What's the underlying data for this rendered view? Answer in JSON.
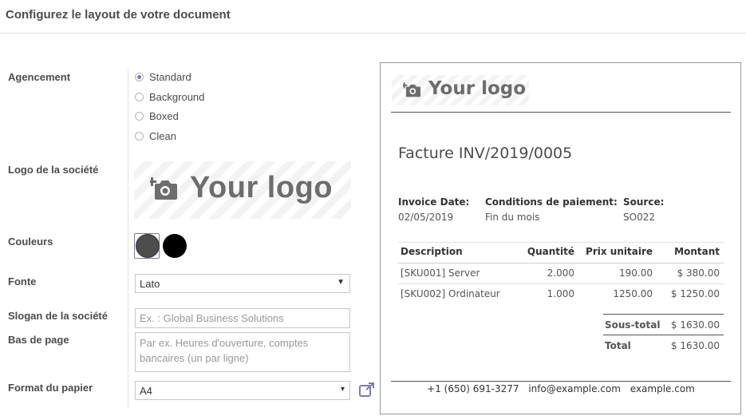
{
  "header": {
    "title": "Configurez le layout de votre document"
  },
  "labels": {
    "layout": "Agencement",
    "logo": "Logo de la société",
    "colors": "Couleurs",
    "font": "Fonte",
    "tagline": "Slogan de la société",
    "footer": "Bas de page",
    "paper": "Format du papier"
  },
  "layout_options": [
    {
      "label": "Standard",
      "selected": true
    },
    {
      "label": "Background",
      "selected": false
    },
    {
      "label": "Boxed",
      "selected": false
    },
    {
      "label": "Clean",
      "selected": false
    }
  ],
  "logo_placeholder": "Your logo",
  "colors": {
    "primary": "#4d4d4d",
    "secondary": "#000000",
    "accent": "#7c7bad"
  },
  "font": {
    "value": "Lato"
  },
  "tagline": {
    "placeholder": "Ex. : Global Business Solutions"
  },
  "footer_field": {
    "placeholder": "Par ex. Heures d'ouverture, comptes bancaires (un par ligne)"
  },
  "paper": {
    "value": "A4"
  },
  "preview": {
    "logo_text": "Your logo",
    "title": "Facture INV/2019/0005",
    "meta": [
      {
        "label": "Invoice Date:",
        "value": "02/05/2019"
      },
      {
        "label": "Conditions de paiement:",
        "value": "Fin du mois"
      },
      {
        "label": "Source:",
        "value": "SO022"
      }
    ],
    "columns": [
      "Description",
      "Quantité",
      "Prix unitaire",
      "Montant"
    ],
    "rows": [
      [
        "[SKU001] Server",
        "2.000",
        "190.00",
        "$ 380.00"
      ],
      [
        "[SKU002] Ordinateur",
        "1.000",
        "1250.00",
        "$ 1250.00"
      ]
    ],
    "subtotal_label": "Sous-total",
    "subtotal_value": "$ 1630.00",
    "total_label": "Total",
    "total_value": "$ 1630.00",
    "footer": {
      "phone": "+1 (650) 691-3277",
      "email": "info@example.com",
      "website": "example.com"
    }
  }
}
